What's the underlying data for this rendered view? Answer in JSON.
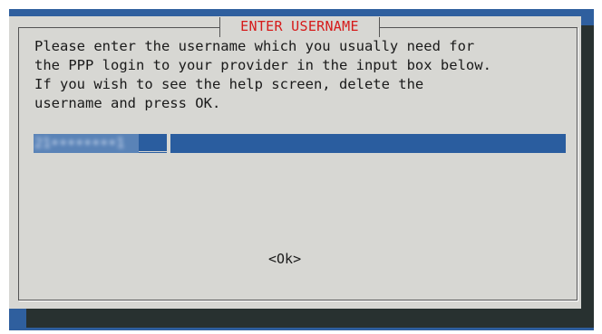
{
  "dialog": {
    "title": "ENTER USERNAME",
    "message_lines": [
      "Please enter the username which you usually need for",
      "the PPP login to your provider in the input box below.",
      "If you wish to see the help screen, delete the",
      "username and press OK."
    ],
    "input": {
      "value": "21••••••••1"
    },
    "ok_label": "<Ok>"
  },
  "colors": {
    "background": "#2f5f9e",
    "dialog": "#d7d7d3",
    "title": "#d61a1a",
    "input": "#2a5d9f",
    "shadow": "#283130"
  }
}
